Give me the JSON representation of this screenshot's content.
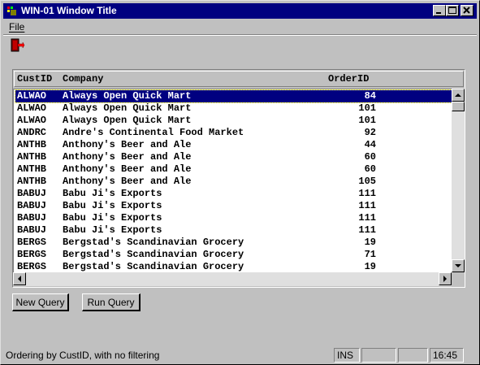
{
  "window": {
    "title": "WIN-01 Window Title"
  },
  "menu": {
    "file_label": "File",
    "file_mnemonic": "F",
    "file_rest": "ile"
  },
  "grid": {
    "headers": {
      "custid": "CustID",
      "company": "Company",
      "orderid": "OrderID"
    },
    "rows": [
      {
        "custid": "ALWAO",
        "company": "Always Open Quick Mart",
        "orderid": "84",
        "selected": true
      },
      {
        "custid": "ALWAO",
        "company": "Always Open Quick Mart",
        "orderid": "101"
      },
      {
        "custid": "ALWAO",
        "company": "Always Open Quick Mart",
        "orderid": "101"
      },
      {
        "custid": "ANDRC",
        "company": "Andre's Continental Food Market",
        "orderid": "92"
      },
      {
        "custid": "ANTHB",
        "company": "Anthony's Beer and Ale",
        "orderid": "44"
      },
      {
        "custid": "ANTHB",
        "company": "Anthony's Beer and Ale",
        "orderid": "60"
      },
      {
        "custid": "ANTHB",
        "company": "Anthony's Beer and Ale",
        "orderid": "60"
      },
      {
        "custid": "ANTHB",
        "company": "Anthony's Beer and Ale",
        "orderid": "105"
      },
      {
        "custid": "BABUJ",
        "company": "Babu Ji's Exports",
        "orderid": "111"
      },
      {
        "custid": "BABUJ",
        "company": "Babu Ji's Exports",
        "orderid": "111"
      },
      {
        "custid": "BABUJ",
        "company": "Babu Ji's Exports",
        "orderid": "111"
      },
      {
        "custid": "BABUJ",
        "company": "Babu Ji's Exports",
        "orderid": "111"
      },
      {
        "custid": "BERGS",
        "company": "Bergstad's Scandinavian Grocery",
        "orderid": "19"
      },
      {
        "custid": "BERGS",
        "company": "Bergstad's Scandinavian Grocery",
        "orderid": "71"
      },
      {
        "custid": "BERGS",
        "company": "Bergstad's Scandinavian Grocery",
        "orderid": "19"
      }
    ]
  },
  "buttons": {
    "new_query": "New Query",
    "run_query": "Run Query"
  },
  "status": {
    "message": "Ordering by CustID,  with no filtering",
    "ins": "INS",
    "pane2": "",
    "pane3": "",
    "time": "16:45"
  },
  "colors": {
    "title_bg": "#000080",
    "face": "#c0c0c0",
    "selection": "#000080"
  },
  "icons": [
    "app-icon",
    "minimize-icon",
    "maximize-icon",
    "close-icon",
    "exit-door-icon",
    "scroll-up-icon",
    "scroll-down-icon",
    "scroll-left-icon",
    "scroll-right-icon"
  ]
}
